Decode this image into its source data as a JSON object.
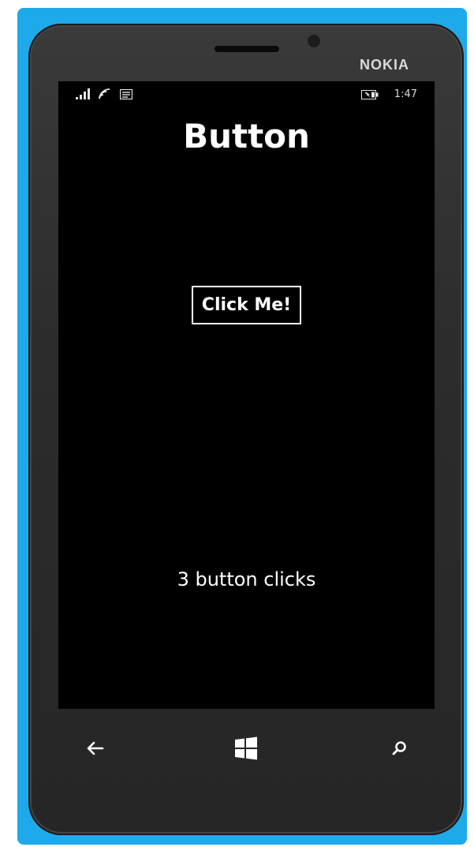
{
  "device": {
    "brand": "NOKIA"
  },
  "status_bar": {
    "time": "1:47",
    "icons": [
      "signal-icon",
      "wifi-icon",
      "message-icon",
      "battery-icon"
    ]
  },
  "page": {
    "title": "Button",
    "button_label": "Click Me!",
    "click_count_text": "3 button clicks"
  },
  "nav": {
    "icons": [
      "back-arrow-icon",
      "windows-start-icon",
      "search-icon"
    ]
  },
  "colors": {
    "shell": "#1ea9ea",
    "screen": "#000000",
    "text": "#ffffff"
  }
}
